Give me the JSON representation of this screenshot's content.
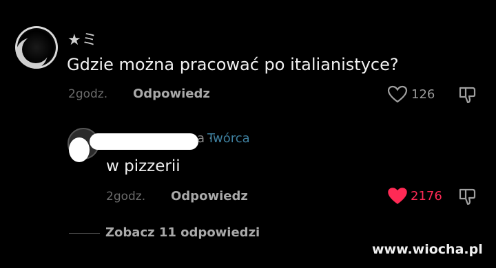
{
  "comment": {
    "username": "★ミ",
    "text": "Gdzie można pracować po italianistyce?",
    "time": "2godz.",
    "reply_label": "Odpowiedz",
    "likes": "126"
  },
  "reply": {
    "name_tail": "a ·",
    "creator_badge": "Twórca",
    "text": "w pizzerii",
    "time": "2godz.",
    "reply_label": "Odpowiedz",
    "likes": "2176",
    "liked": true
  },
  "view_replies": "Zobacz 11 odpowiedzi",
  "watermark": "www.wiocha.pl",
  "colors": {
    "background": "#000000",
    "like_active": "#ff2a55",
    "creator": "#3e7f9e"
  },
  "icons": [
    "heart-icon",
    "dislike-icon",
    "heart-filled-icon"
  ]
}
